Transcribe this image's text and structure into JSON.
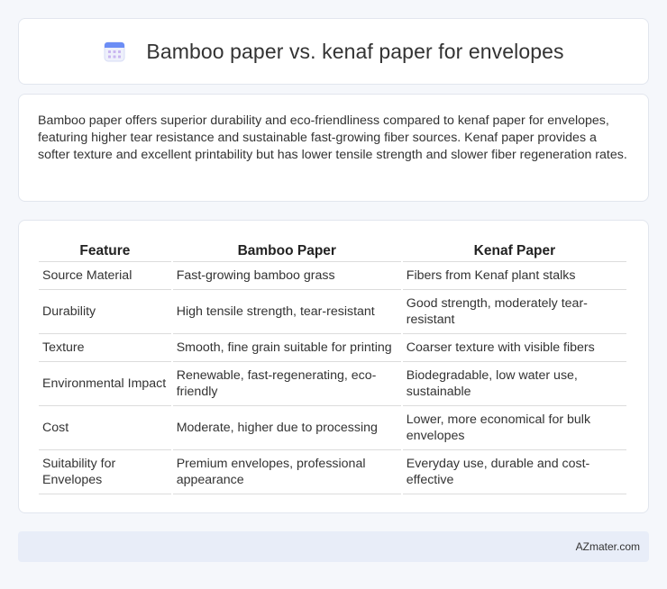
{
  "header": {
    "icon": "calendar-icon",
    "title": "Bamboo paper vs. kenaf paper for envelopes"
  },
  "intro": {
    "text": "Bamboo paper offers superior durability and eco-friendliness compared to kenaf paper for envelopes, featuring higher tear resistance and sustainable fast-growing fiber sources. Kenaf paper provides a softer texture and excellent printability but has lower tensile strength and slower fiber regeneration rates."
  },
  "table": {
    "headers": [
      "Feature",
      "Bamboo Paper",
      "Kenaf Paper"
    ],
    "rows": [
      [
        "Source Material",
        "Fast-growing bamboo grass",
        "Fibers from Kenaf plant stalks"
      ],
      [
        "Durability",
        "High tensile strength, tear-resistant",
        "Good strength, moderately tear-resistant"
      ],
      [
        "Texture",
        "Smooth, fine grain suitable for printing",
        "Coarser texture with visible fibers"
      ],
      [
        "Environmental Impact",
        "Renewable, fast-regenerating, eco-friendly",
        "Biodegradable, low water use, sustainable"
      ],
      [
        "Cost",
        "Moderate, higher due to processing",
        "Lower, more economical for bulk envelopes"
      ],
      [
        "Suitability for Envelopes",
        "Premium envelopes, professional appearance",
        "Everyday use, durable and cost-effective"
      ]
    ]
  },
  "footer": {
    "brand": "AZmater.com"
  },
  "colors": {
    "background": "#f5f7fb",
    "footer_bg": "#e8edf8",
    "icon_accent": "#6b8df5",
    "icon_grid": "#c9b6f0"
  }
}
